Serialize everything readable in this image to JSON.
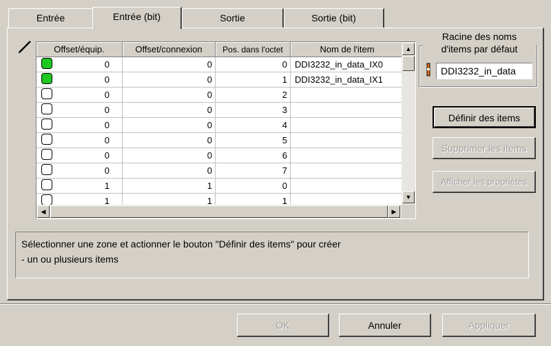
{
  "tabs": [
    {
      "label": "Entrée"
    },
    {
      "label": "Entrée (bit)"
    },
    {
      "label": "Sortie"
    },
    {
      "label": "Sortie (bit)"
    }
  ],
  "table": {
    "columns": [
      "Offset/équip.",
      "Offset/connexion",
      "Pos. dans l'octet",
      "Nom de l'item"
    ],
    "rows": [
      {
        "active": true,
        "offset_equip": "0",
        "offset_conn": "0",
        "pos": "0",
        "name": "DDI3232_in_data_IX0"
      },
      {
        "active": true,
        "offset_equip": "0",
        "offset_conn": "0",
        "pos": "1",
        "name": "DDI3232_in_data_IX1"
      },
      {
        "active": false,
        "offset_equip": "0",
        "offset_conn": "0",
        "pos": "2",
        "name": ""
      },
      {
        "active": false,
        "offset_equip": "0",
        "offset_conn": "0",
        "pos": "3",
        "name": ""
      },
      {
        "active": false,
        "offset_equip": "0",
        "offset_conn": "0",
        "pos": "4",
        "name": ""
      },
      {
        "active": false,
        "offset_equip": "0",
        "offset_conn": "0",
        "pos": "5",
        "name": ""
      },
      {
        "active": false,
        "offset_equip": "0",
        "offset_conn": "0",
        "pos": "6",
        "name": ""
      },
      {
        "active": false,
        "offset_equip": "0",
        "offset_conn": "0",
        "pos": "7",
        "name": ""
      },
      {
        "active": false,
        "offset_equip": "1",
        "offset_conn": "1",
        "pos": "0",
        "name": ""
      },
      {
        "active": false,
        "offset_equip": "1",
        "offset_conn": "1",
        "pos": "1",
        "name": ""
      }
    ]
  },
  "root_group": {
    "label_line1": "Racine des noms",
    "label_line2": "d'items par défaut",
    "value": "DDI3232_in_data"
  },
  "side_buttons": {
    "define": "Définir des items",
    "delete": "Supprimer les items",
    "properties": "Afficher les propriétés"
  },
  "info": {
    "line1": "Sélectionner une zone et actionner le bouton \"Définir des items\" pour créer",
    "line2": "- un ou plusieurs items"
  },
  "footer": {
    "ok": "OK",
    "cancel": "Annuler",
    "apply": "Appliquer"
  },
  "colors": {
    "active_led": "#1ec81e",
    "background": "#d4d0c8"
  }
}
